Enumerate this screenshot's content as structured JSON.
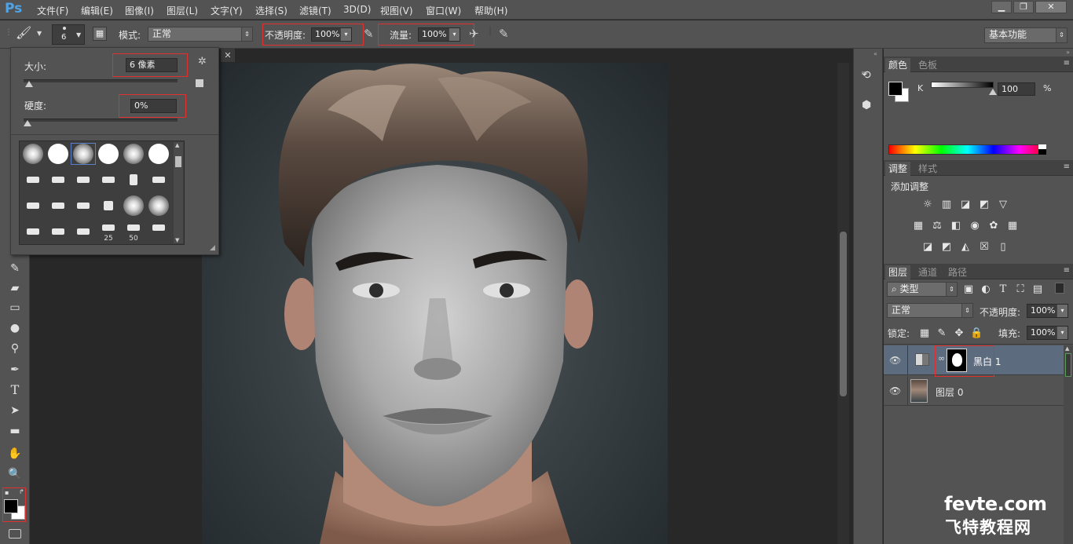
{
  "app": {
    "logo": "Ps"
  },
  "menu": [
    "文件(F)",
    "编辑(E)",
    "图像(I)",
    "图层(L)",
    "文字(Y)",
    "选择(S)",
    "滤镜(T)",
    "3D(D)",
    "视图(V)",
    "窗口(W)",
    "帮助(H)"
  ],
  "window_controls": [
    "minimize-icon",
    "restore-icon",
    "close-icon"
  ],
  "options": {
    "brush_size_value": "6",
    "mode_label": "模式:",
    "mode_value": "正常",
    "opacity_label": "不透明度:",
    "opacity_value": "100%",
    "flow_label": "流量:",
    "flow_value": "100%",
    "workspace": "基本功能"
  },
  "brush_picker": {
    "size_label": "大小:",
    "size_value": "6 像素",
    "size_fraction": 0.01,
    "hardness_label": "硬度:",
    "hardness_value": "0%",
    "hardness_fraction": 0.0,
    "presets_numbers": [
      "25",
      "50"
    ]
  },
  "tools": [
    "brush-icon",
    "eraser-icon",
    "gradient-icon",
    "blur-icon",
    "dodge-icon",
    "pen-icon",
    "type-icon",
    "path-select-icon",
    "rectangle-icon",
    "hand-icon",
    "zoom-icon"
  ],
  "colors": {
    "foreground": "#000000",
    "background": "#ffffff",
    "accent_red": "#e03030",
    "ps_blue": "#4fa3e6"
  },
  "color_panel": {
    "tabs": [
      "颜色",
      "色板"
    ],
    "channel_label": "K",
    "channel_value": "100",
    "channel_unit": "%"
  },
  "adjust_panel": {
    "tabs": [
      "调整",
      "样式"
    ],
    "title": "添加调整"
  },
  "layers_panel": {
    "tabs": [
      "图层",
      "通道",
      "路径"
    ],
    "filter_value": "类型",
    "blend_value": "正常",
    "opacity_label": "不透明度:",
    "opacity_value": "100%",
    "lock_label": "锁定:",
    "fill_label": "填充:",
    "fill_value": "100%",
    "layers": [
      {
        "name": "黑白 1",
        "type": "adjustment",
        "selected": true
      },
      {
        "name": "图层 0",
        "type": "pixel",
        "selected": false
      }
    ]
  },
  "watermark": {
    "line1": "fevte.com",
    "line2": "飞特教程网"
  }
}
